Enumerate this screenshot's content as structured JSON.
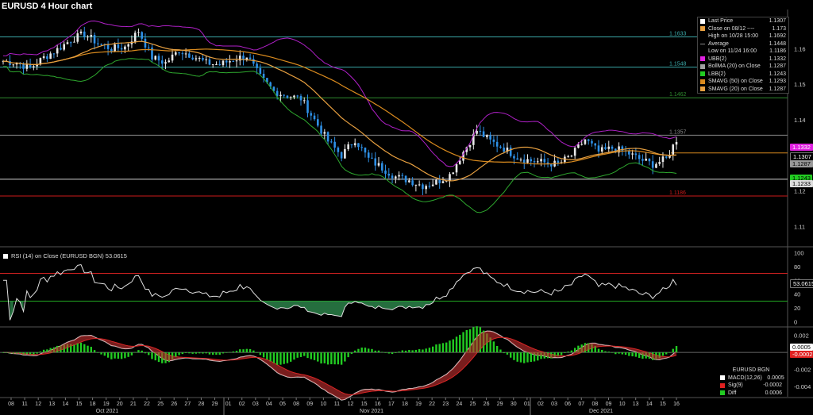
{
  "title": "EURUSD 4 Hour chart",
  "colors": {
    "bg": "#000000",
    "up": "#e8e8e8",
    "down": "#2e90e6",
    "ubb": "#b020c8",
    "lbb": "#2ea82e",
    "sma50": "#d98a1e",
    "sma20": "#e8a040",
    "rsi": "#e0e0e0",
    "macd": "#d8d8d8",
    "signal": "#e02020",
    "diff": "#22cc22"
  },
  "legend": {
    "main": [
      {
        "label": "Last Price",
        "value": "1.1307",
        "icon": "square",
        "color": "#ffffff"
      },
      {
        "label": "Close on 08/12 ----",
        "value": "1.173",
        "icon": "square",
        "color": "#e8a040"
      },
      {
        "label": "High on 10/28 15:00",
        "value": "1.1692",
        "icon": "none",
        "color": ""
      },
      {
        "label": "Average",
        "value": "1.1448",
        "icon": "dash",
        "color": "#888888"
      },
      {
        "label": "Low on 11/24 16:00",
        "value": "1.1186",
        "icon": "none",
        "color": ""
      },
      {
        "label": "UBB(2)",
        "value": "1.1332",
        "icon": "square",
        "color": "#e020e0"
      },
      {
        "label": "BollMA (20)  on Close",
        "value": "1.1287",
        "icon": "square",
        "color": "#a0a0a0"
      },
      {
        "label": "LBB(2)",
        "value": "1.1243",
        "icon": "square",
        "color": "#22cc22"
      },
      {
        "label": "SMAVG (50)  on Close",
        "value": "1.1293",
        "icon": "square",
        "color": "#d98a1e"
      },
      {
        "label": "SMAVG (20)  on Close",
        "value": "1.1287",
        "icon": "square",
        "color": "#e8a040"
      }
    ],
    "rsi": "RSI (14)  on Close (EURUSD BGN) 53.0615",
    "macd_header": "EURUSD BGN",
    "macd": [
      {
        "label": "MACD(12,26)",
        "value": "0.0005",
        "color": "#ffffff"
      },
      {
        "label": "Sig(9)",
        "value": "-0.0002",
        "color": "#e02020"
      },
      {
        "label": "Diff",
        "value": "0.0006",
        "color": "#22cc22"
      }
    ]
  },
  "tags": {
    "ubb": "1.1332",
    "last": "1.1307",
    "bollma": "1.1287",
    "lbb": "1.1243",
    "level": "1.1233",
    "rsi": "53.0615",
    "macd": "0.0005",
    "sig": "-0.0002"
  },
  "chart_data": [
    {
      "type": "candlestick",
      "title": "EURUSD 4 Hour chart",
      "x_ticks": [
        "08",
        "11",
        "12",
        "13",
        "14",
        "15",
        "18",
        "19",
        "20",
        "21",
        "22",
        "25",
        "26",
        "27",
        "28",
        "29",
        "01",
        "02",
        "03",
        "04",
        "05",
        "08",
        "09",
        "10",
        "11",
        "12",
        "15",
        "16",
        "17",
        "18",
        "19",
        "22",
        "23",
        "24",
        "25",
        "26",
        "29",
        "30",
        "01",
        "02",
        "03",
        "06",
        "07",
        "08",
        "09",
        "10",
        "13",
        "14",
        "15",
        "16"
      ],
      "month_labels": [
        "Oct 2021",
        "Nov 2021",
        "Dec 2021"
      ],
      "y_ticks": [
        1.11,
        1.12,
        1.13,
        1.14,
        1.15,
        1.16
      ],
      "ylim": [
        1.105,
        1.171
      ],
      "horizontal_lines": [
        {
          "value": 1.1633,
          "label": "1.1633",
          "color": "#3aa8a8"
        },
        {
          "value": 1.1548,
          "label": "1.1548",
          "color": "#3aa8a8"
        },
        {
          "value": 1.1462,
          "label": "1.1462",
          "color": "#2e8a2e"
        },
        {
          "value": 1.1357,
          "label": "1.1357",
          "color": "#888888"
        },
        {
          "value": 1.1233,
          "label": "",
          "color": "#d0d0d0"
        },
        {
          "value": 1.1186,
          "label": "1.1186",
          "color": "#cc1a1a"
        },
        {
          "value": 1.1307,
          "label": "",
          "color": "#d98a1e"
        }
      ],
      "close_anchors": [
        [
          0,
          1.1565
        ],
        [
          4,
          1.156
        ],
        [
          8,
          1.1545
        ],
        [
          12,
          1.1575
        ],
        [
          16,
          1.1598
        ],
        [
          20,
          1.1625
        ],
        [
          24,
          1.1642
        ],
        [
          28,
          1.1615
        ],
        [
          32,
          1.16
        ],
        [
          36,
          1.1605
        ],
        [
          40,
          1.165
        ],
        [
          44,
          1.1575
        ],
        [
          48,
          1.156
        ],
        [
          52,
          1.1595
        ],
        [
          56,
          1.158
        ],
        [
          60,
          1.156
        ],
        [
          64,
          1.1555
        ],
        [
          68,
          1.157
        ],
        [
          72,
          1.158
        ],
        [
          76,
          1.152
        ],
        [
          80,
          1.148
        ],
        [
          84,
          1.1468
        ],
        [
          88,
          1.146
        ],
        [
          92,
          1.14
        ],
        [
          96,
          1.134
        ],
        [
          100,
          1.13
        ],
        [
          104,
          1.1345
        ],
        [
          108,
          1.129
        ],
        [
          112,
          1.1265
        ],
        [
          116,
          1.124
        ],
        [
          120,
          1.123
        ],
        [
          124,
          1.1215
        ],
        [
          128,
          1.1225
        ],
        [
          132,
          1.1245
        ],
        [
          136,
          1.131
        ],
        [
          140,
          1.137
        ],
        [
          144,
          1.134
        ],
        [
          148,
          1.132
        ],
        [
          152,
          1.1295
        ],
        [
          156,
          1.1285
        ],
        [
          160,
          1.128
        ],
        [
          164,
          1.1275
        ],
        [
          168,
          1.13
        ],
        [
          172,
          1.1345
        ],
        [
          176,
          1.131
        ],
        [
          180,
          1.132
        ],
        [
          184,
          1.131
        ],
        [
          188,
          1.129
        ],
        [
          192,
          1.1275
        ],
        [
          196,
          1.129
        ],
        [
          199,
          1.1345
        ]
      ],
      "series": [
        {
          "name": "UBB(2)",
          "last": 1.1332
        },
        {
          "name": "BollMA (20)",
          "last": 1.1287
        },
        {
          "name": "LBB(2)",
          "last": 1.1243
        },
        {
          "name": "SMAVG (50)",
          "last": 1.1293
        },
        {
          "name": "SMAVG (20)",
          "last": 1.1287
        }
      ]
    },
    {
      "type": "line",
      "title": "RSI (14) on Close (EURUSD BGN)",
      "y_ticks": [
        0,
        20,
        40,
        60,
        80,
        100
      ],
      "ylim": [
        -5,
        105
      ],
      "bands": [
        70,
        30
      ],
      "last": 53.0615
    },
    {
      "type": "line",
      "title": "MACD(12,26)",
      "y_ticks": [
        0.002,
        0,
        -0.002,
        -0.004
      ],
      "ylim": [
        -0.0052,
        0.0028
      ],
      "series": [
        {
          "name": "MACD(12,26)",
          "last": 0.0005
        },
        {
          "name": "Sig(9)",
          "last": -0.0002
        },
        {
          "name": "Diff",
          "last": 0.0006
        }
      ]
    }
  ]
}
